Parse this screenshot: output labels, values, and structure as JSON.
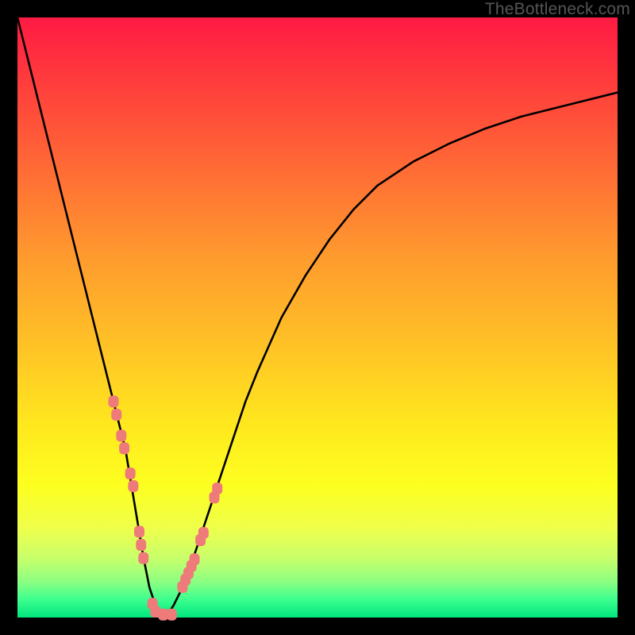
{
  "watermark": "TheBottleneck.com",
  "colors": {
    "frame": "#000000",
    "curve": "#000000",
    "marker_fill": "#ee7a7a",
    "marker_stroke": "#d05454"
  },
  "chart_data": {
    "type": "line",
    "title": "",
    "xlabel": "",
    "ylabel": "",
    "xlim": [
      0,
      100
    ],
    "ylim": [
      0,
      100
    ],
    "grid": false,
    "series": [
      {
        "name": "bottleneck-curve",
        "x": [
          0,
          2,
          4,
          6,
          8,
          10,
          12,
          14,
          16,
          18,
          20,
          21,
          22,
          23,
          24,
          25,
          26,
          28,
          30,
          32,
          34,
          36,
          38,
          40,
          44,
          48,
          52,
          56,
          60,
          66,
          72,
          78,
          84,
          90,
          96,
          100
        ],
        "values": [
          100,
          92,
          84,
          76,
          68,
          60,
          52,
          44,
          36,
          28,
          16,
          10,
          5,
          2,
          0.5,
          0.5,
          2,
          6,
          12,
          18,
          24,
          30,
          36,
          41,
          50,
          57,
          63,
          68,
          72,
          76,
          79,
          81.5,
          83.5,
          85,
          86.5,
          87.5
        ]
      }
    ],
    "markers": {
      "name": "highlight-dots",
      "x": [
        16.0,
        16.5,
        17.3,
        17.8,
        18.8,
        19.3,
        20.3,
        20.6,
        21.0,
        22.5,
        23.0,
        24.3,
        25.7,
        27.5,
        28.0,
        28.5,
        29.0,
        29.5,
        30.5,
        31.0,
        32.8,
        33.3
      ],
      "values": [
        36.0,
        33.8,
        30.3,
        28.2,
        24.0,
        21.9,
        14.3,
        12.1,
        9.9,
        2.3,
        1.0,
        0.5,
        0.5,
        5.1,
        6.3,
        7.4,
        8.6,
        9.7,
        12.9,
        14.1,
        20.0,
        21.5
      ]
    }
  }
}
